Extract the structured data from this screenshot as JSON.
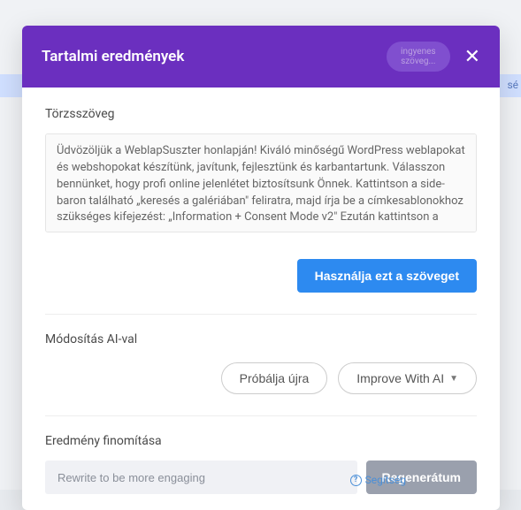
{
  "backdrop": {
    "right_text": "sé"
  },
  "header": {
    "title": "Tartalmi eredmények",
    "pill_line1": "ingyenes",
    "pill_line2": "szöveg..."
  },
  "body": {
    "section_label": "Törzsszöveg",
    "textarea_value": "Üdvözöljük a WeblapSuszter honlapján! Kiváló minőségű WordPress weblapokat és webshopokat készítünk, javítunk, fejlesztünk és karbantartunk. Válasszon bennünket, hogy profi online jelenlétet biztosítsunk Önnek. Kattintson a side-baron található „keresés a galériában\" feliratra, majd írja be a címkesablonokhoz szükséges kifejezést: „Information + Consent Mode v2\" Ezután kattintson a",
    "use_text_btn": "Használja ezt a szöveget"
  },
  "modify": {
    "label": "Módosítás AI-val",
    "retry_btn": "Próbálja újra",
    "improve_btn": "Improve With AI"
  },
  "refine": {
    "label": "Eredmény finomítása",
    "placeholder": "Rewrite to be more engaging",
    "regen_btn": "Regenerátum"
  },
  "footer": {
    "help": "Segítség"
  }
}
